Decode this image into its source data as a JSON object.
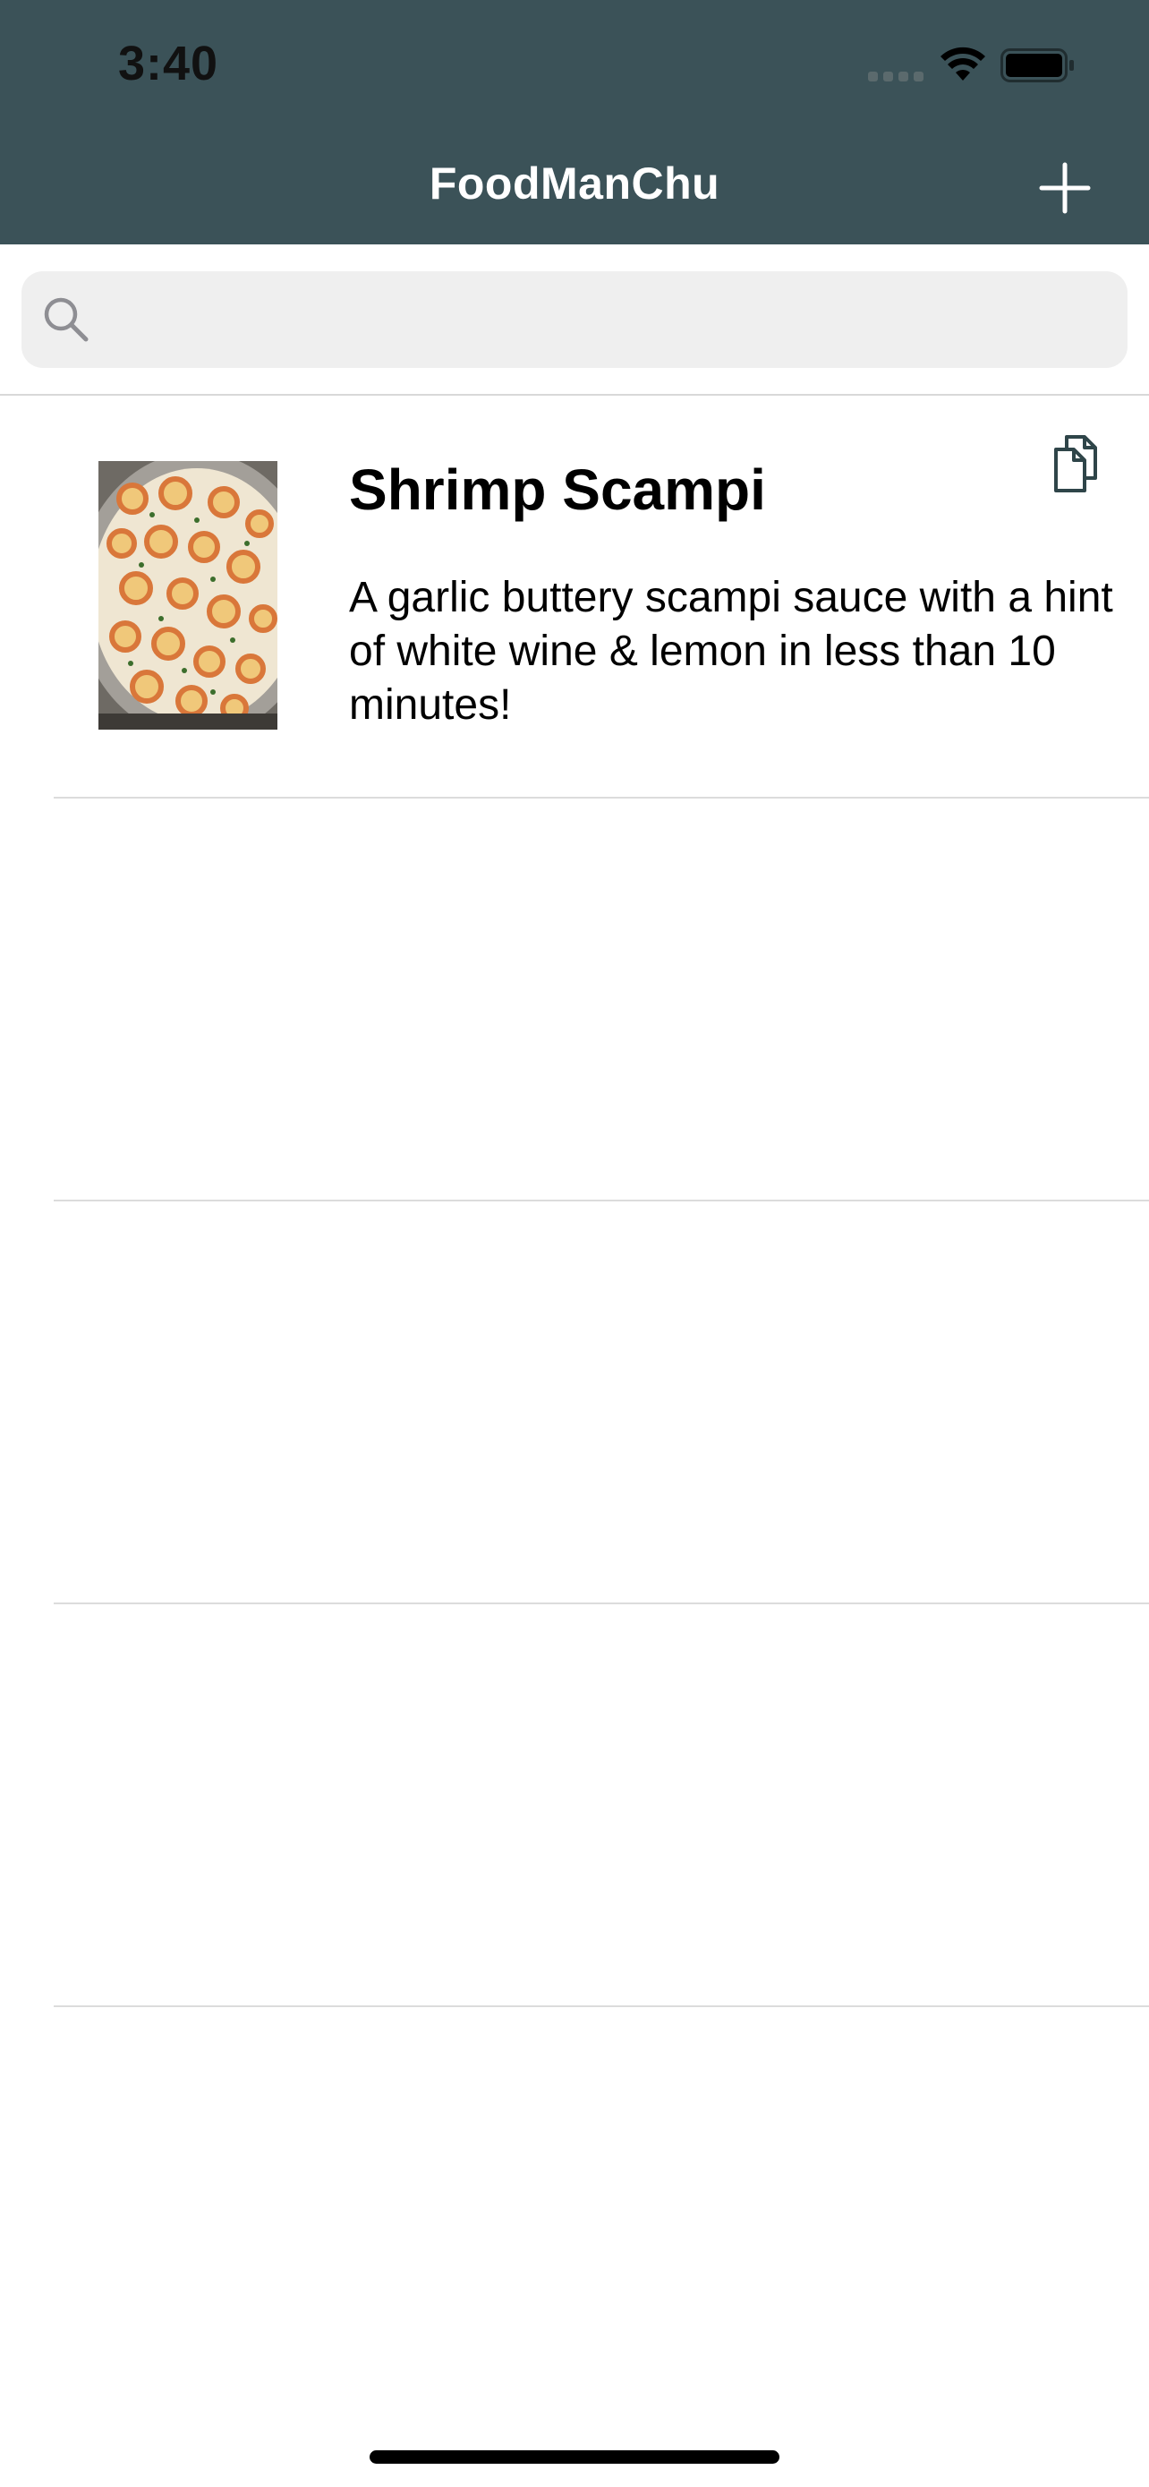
{
  "status_bar": {
    "time": "3:40"
  },
  "nav": {
    "title": "FoodManChu",
    "add_icon": "plus-icon"
  },
  "search": {
    "placeholder": "",
    "value": ""
  },
  "recipes": [
    {
      "title": "Shrimp Scampi",
      "description": "A garlic buttery scampi sauce with a hint of white wine & lemon in less than 10 minutes!",
      "image": "shrimp-scampi-photo",
      "action_icon": "copy-icon"
    }
  ],
  "colors": {
    "header_bg": "#3b5258",
    "header_text": "#ffffff",
    "search_bg": "#efefef",
    "separator": "#dcdcdc"
  }
}
